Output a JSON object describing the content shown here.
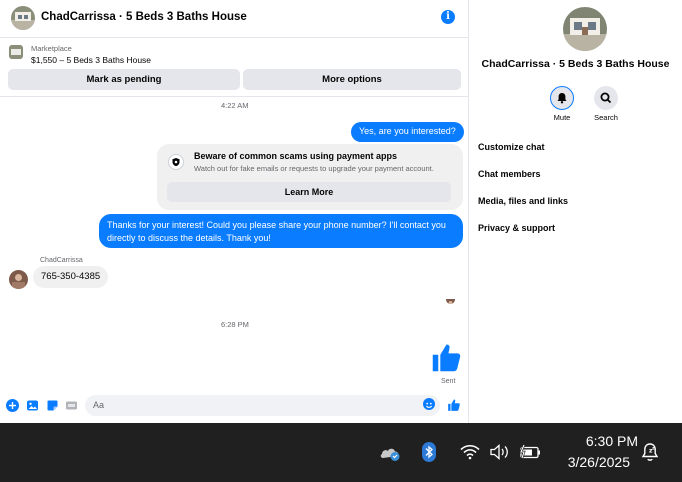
{
  "chat": {
    "title": "ChadCarrissa · 5 Beds 3 Baths House",
    "info_icon": "info-icon",
    "listing": {
      "category": "Marketplace",
      "title": "$1,550 – 5 Beds 3 Baths House",
      "pending_label": "Mark as pending",
      "more_label": "More options"
    },
    "messages": {
      "time1": "4:22 AM",
      "out1": "Yes, are you interested?",
      "scam_title": "Beware of common scams using payment apps",
      "scam_sub": "Watch out for fake emails or requests to upgrade your payment account.",
      "learn_more": "Learn More",
      "out2_line1": "Thanks for your interest! Could you please share your phone number? I'll contact you",
      "out2_line2": "directly to discuss the details. Thank you!",
      "sender_name": "ChadCarrissa",
      "in1": "765-350-4385",
      "time2": "6:28 PM",
      "sent_label": "Sent"
    },
    "composer": {
      "placeholder": "Aa"
    }
  },
  "info_panel": {
    "name": "ChadCarrissa · 5 Beds 3 Baths House",
    "mute_label": "Mute",
    "search_label": "Search",
    "rows": [
      "Customize chat",
      "Chat members",
      "Media, files and links",
      "Privacy & support"
    ]
  },
  "taskbar": {
    "time": "6:30 PM",
    "date": "3/26/2025"
  },
  "colors": {
    "accent": "#0a7cff",
    "taskbar": "#202020",
    "bubble_in": "#f0f0f0"
  }
}
